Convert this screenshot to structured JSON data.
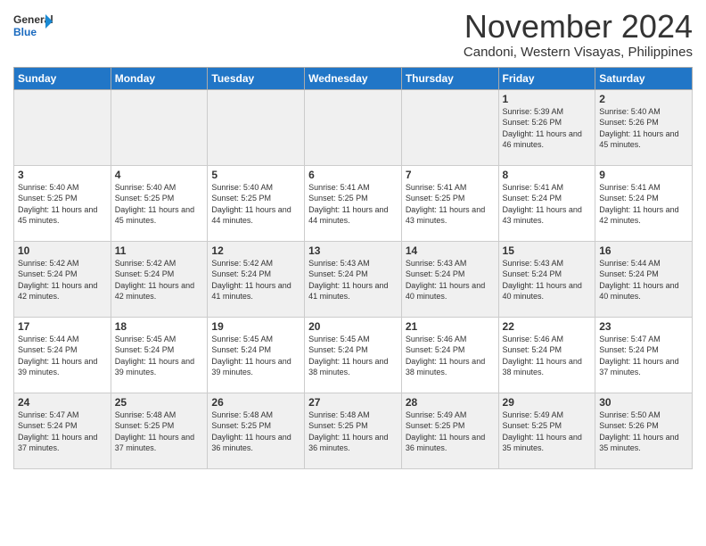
{
  "logo": {
    "line1": "General",
    "line2": "Blue"
  },
  "title": "November 2024",
  "subtitle": "Candoni, Western Visayas, Philippines",
  "weekdays": [
    "Sunday",
    "Monday",
    "Tuesday",
    "Wednesday",
    "Thursday",
    "Friday",
    "Saturday"
  ],
  "weeks": [
    [
      {
        "day": "",
        "info": ""
      },
      {
        "day": "",
        "info": ""
      },
      {
        "day": "",
        "info": ""
      },
      {
        "day": "",
        "info": ""
      },
      {
        "day": "",
        "info": ""
      },
      {
        "day": "1",
        "info": "Sunrise: 5:39 AM\nSunset: 5:26 PM\nDaylight: 11 hours and 46 minutes."
      },
      {
        "day": "2",
        "info": "Sunrise: 5:40 AM\nSunset: 5:26 PM\nDaylight: 11 hours and 45 minutes."
      }
    ],
    [
      {
        "day": "3",
        "info": "Sunrise: 5:40 AM\nSunset: 5:25 PM\nDaylight: 11 hours and 45 minutes."
      },
      {
        "day": "4",
        "info": "Sunrise: 5:40 AM\nSunset: 5:25 PM\nDaylight: 11 hours and 45 minutes."
      },
      {
        "day": "5",
        "info": "Sunrise: 5:40 AM\nSunset: 5:25 PM\nDaylight: 11 hours and 44 minutes."
      },
      {
        "day": "6",
        "info": "Sunrise: 5:41 AM\nSunset: 5:25 PM\nDaylight: 11 hours and 44 minutes."
      },
      {
        "day": "7",
        "info": "Sunrise: 5:41 AM\nSunset: 5:25 PM\nDaylight: 11 hours and 43 minutes."
      },
      {
        "day": "8",
        "info": "Sunrise: 5:41 AM\nSunset: 5:24 PM\nDaylight: 11 hours and 43 minutes."
      },
      {
        "day": "9",
        "info": "Sunrise: 5:41 AM\nSunset: 5:24 PM\nDaylight: 11 hours and 42 minutes."
      }
    ],
    [
      {
        "day": "10",
        "info": "Sunrise: 5:42 AM\nSunset: 5:24 PM\nDaylight: 11 hours and 42 minutes."
      },
      {
        "day": "11",
        "info": "Sunrise: 5:42 AM\nSunset: 5:24 PM\nDaylight: 11 hours and 42 minutes."
      },
      {
        "day": "12",
        "info": "Sunrise: 5:42 AM\nSunset: 5:24 PM\nDaylight: 11 hours and 41 minutes."
      },
      {
        "day": "13",
        "info": "Sunrise: 5:43 AM\nSunset: 5:24 PM\nDaylight: 11 hours and 41 minutes."
      },
      {
        "day": "14",
        "info": "Sunrise: 5:43 AM\nSunset: 5:24 PM\nDaylight: 11 hours and 40 minutes."
      },
      {
        "day": "15",
        "info": "Sunrise: 5:43 AM\nSunset: 5:24 PM\nDaylight: 11 hours and 40 minutes."
      },
      {
        "day": "16",
        "info": "Sunrise: 5:44 AM\nSunset: 5:24 PM\nDaylight: 11 hours and 40 minutes."
      }
    ],
    [
      {
        "day": "17",
        "info": "Sunrise: 5:44 AM\nSunset: 5:24 PM\nDaylight: 11 hours and 39 minutes."
      },
      {
        "day": "18",
        "info": "Sunrise: 5:45 AM\nSunset: 5:24 PM\nDaylight: 11 hours and 39 minutes."
      },
      {
        "day": "19",
        "info": "Sunrise: 5:45 AM\nSunset: 5:24 PM\nDaylight: 11 hours and 39 minutes."
      },
      {
        "day": "20",
        "info": "Sunrise: 5:45 AM\nSunset: 5:24 PM\nDaylight: 11 hours and 38 minutes."
      },
      {
        "day": "21",
        "info": "Sunrise: 5:46 AM\nSunset: 5:24 PM\nDaylight: 11 hours and 38 minutes."
      },
      {
        "day": "22",
        "info": "Sunrise: 5:46 AM\nSunset: 5:24 PM\nDaylight: 11 hours and 38 minutes."
      },
      {
        "day": "23",
        "info": "Sunrise: 5:47 AM\nSunset: 5:24 PM\nDaylight: 11 hours and 37 minutes."
      }
    ],
    [
      {
        "day": "24",
        "info": "Sunrise: 5:47 AM\nSunset: 5:24 PM\nDaylight: 11 hours and 37 minutes."
      },
      {
        "day": "25",
        "info": "Sunrise: 5:48 AM\nSunset: 5:25 PM\nDaylight: 11 hours and 37 minutes."
      },
      {
        "day": "26",
        "info": "Sunrise: 5:48 AM\nSunset: 5:25 PM\nDaylight: 11 hours and 36 minutes."
      },
      {
        "day": "27",
        "info": "Sunrise: 5:48 AM\nSunset: 5:25 PM\nDaylight: 11 hours and 36 minutes."
      },
      {
        "day": "28",
        "info": "Sunrise: 5:49 AM\nSunset: 5:25 PM\nDaylight: 11 hours and 36 minutes."
      },
      {
        "day": "29",
        "info": "Sunrise: 5:49 AM\nSunset: 5:25 PM\nDaylight: 11 hours and 35 minutes."
      },
      {
        "day": "30",
        "info": "Sunrise: 5:50 AM\nSunset: 5:26 PM\nDaylight: 11 hours and 35 minutes."
      }
    ]
  ]
}
